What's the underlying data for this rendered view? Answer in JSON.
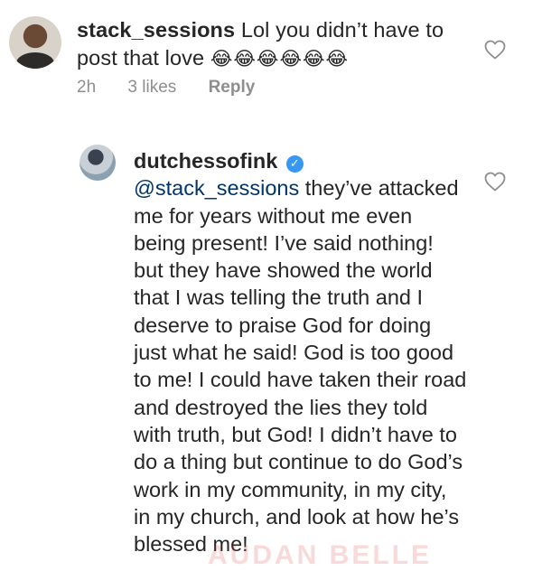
{
  "comments": [
    {
      "username": "stack_sessions",
      "text": "Lol you didn’t have to post that love",
      "emojis": "😂😂😂😂😂😂",
      "time": "2h",
      "likes": "3 likes",
      "reply_label": "Reply",
      "avatar_icon": "user-avatar"
    },
    {
      "username": "dutchessofink",
      "verified_icon": "verified-badge-icon",
      "mention": "@stack_sessions",
      "text": " they’ve attacked me for years without me even being present!  I’ve said nothing! but they have showed the world that I was telling the truth and I deserve to praise God for doing just what he said! God is too good to me! I could have taken their road and destroyed the lies they told with truth, but God! I didn’t have to do a thing but continue to do God’s work in my community, in my city, in my church, and look at how he’s blessed me!",
      "avatar_icon": "user-avatar"
    }
  ],
  "like_icon": "heart-outline-icon",
  "watermark": "AUDAN BELLE"
}
